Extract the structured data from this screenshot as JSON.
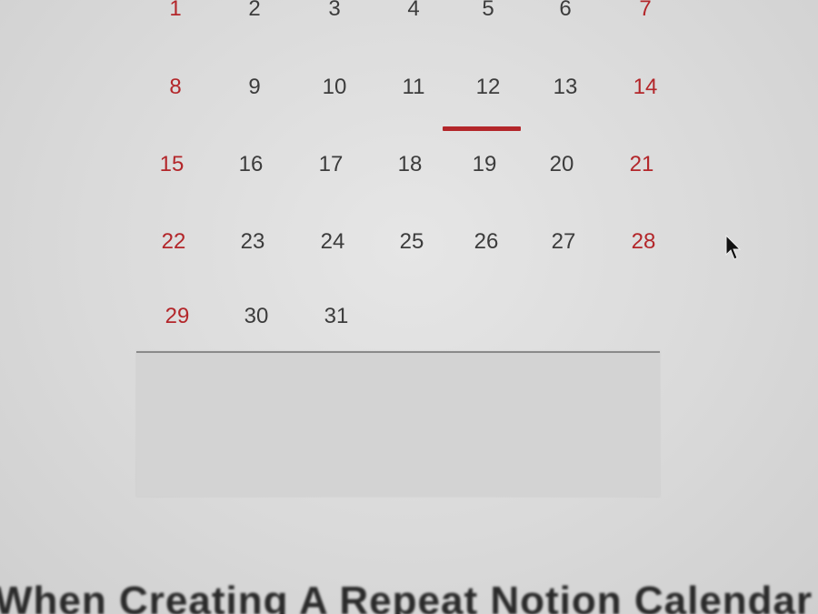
{
  "calendar": {
    "rows": [
      [
        {
          "label": "1",
          "weekend": true
        },
        {
          "label": "2",
          "weekend": false
        },
        {
          "label": "3",
          "weekend": false
        },
        {
          "label": "4",
          "weekend": false
        },
        {
          "label": "5",
          "weekend": false
        },
        {
          "label": "6",
          "weekend": false
        },
        {
          "label": "7",
          "weekend": true
        }
      ],
      [
        {
          "label": "8",
          "weekend": true
        },
        {
          "label": "9",
          "weekend": false
        },
        {
          "label": "10",
          "weekend": false
        },
        {
          "label": "11",
          "weekend": false
        },
        {
          "label": "12",
          "weekend": false,
          "today": true
        },
        {
          "label": "13",
          "weekend": false
        },
        {
          "label": "14",
          "weekend": true
        }
      ],
      [
        {
          "label": "15",
          "weekend": true
        },
        {
          "label": "16",
          "weekend": false
        },
        {
          "label": "17",
          "weekend": false
        },
        {
          "label": "18",
          "weekend": false
        },
        {
          "label": "19",
          "weekend": false
        },
        {
          "label": "20",
          "weekend": false
        },
        {
          "label": "21",
          "weekend": true
        }
      ],
      [
        {
          "label": "22",
          "weekend": true
        },
        {
          "label": "23",
          "weekend": false
        },
        {
          "label": "24",
          "weekend": false
        },
        {
          "label": "25",
          "weekend": false
        },
        {
          "label": "26",
          "weekend": false
        },
        {
          "label": "27",
          "weekend": false
        },
        {
          "label": "28",
          "weekend": true
        }
      ],
      [
        {
          "label": "29",
          "weekend": true
        },
        {
          "label": "30",
          "weekend": false
        },
        {
          "label": "31",
          "weekend": false
        }
      ]
    ],
    "today": "12"
  },
  "colors": {
    "weekend": "#b3262a",
    "weekday": "#3c3c3c",
    "today_underline": "#b3262a",
    "background": "#dcdcdc"
  },
  "cursor_icon": "arrow-cursor-icon",
  "bottom_heading": "When Creating A Repeat Notion Calendar"
}
